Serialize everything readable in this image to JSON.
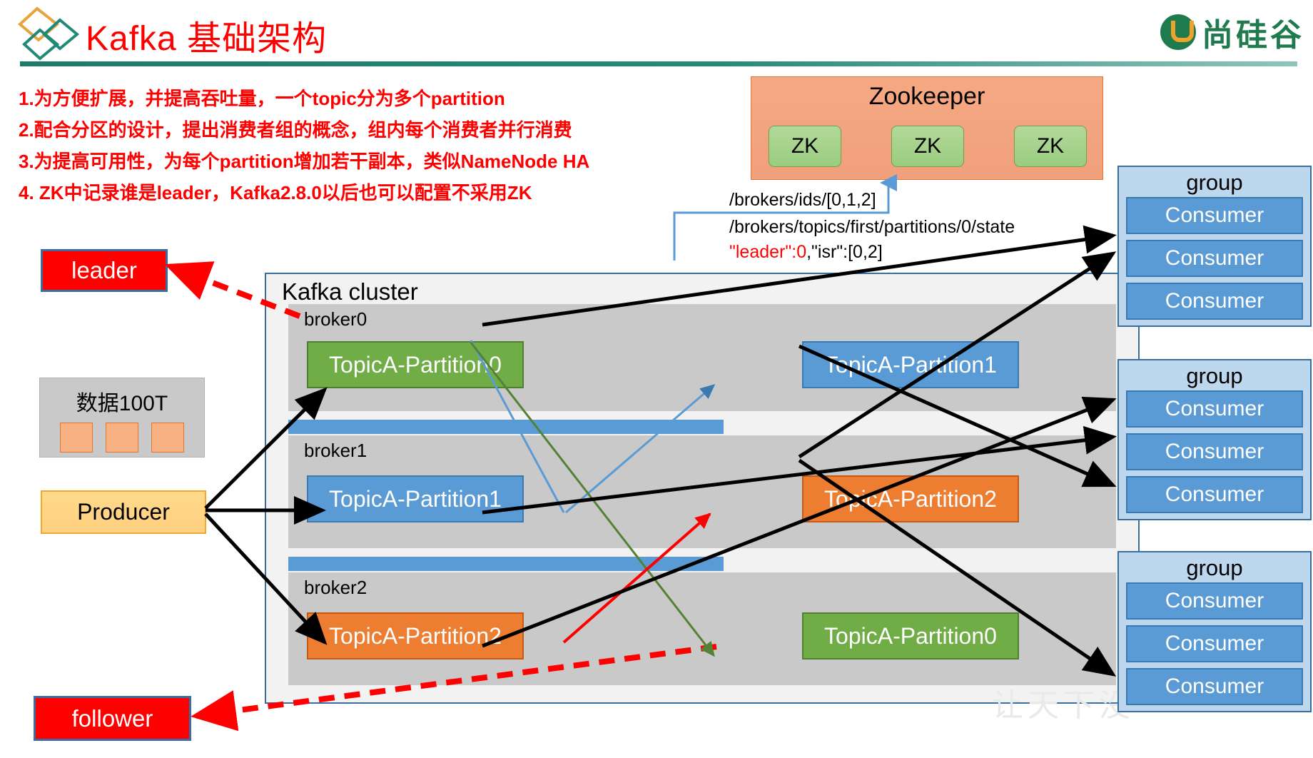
{
  "header": {
    "title": "Kafka 基础架构",
    "logo_icon": "diamonds-logo-icon",
    "brand_text": "尚硅谷",
    "brand_icon": "atguigu-u-mark-icon"
  },
  "notes": [
    "1.为方便扩展，并提高吞吐量，一个topic分为多个partition",
    "2.配合分区的设计，提出消费者组的概念，组内每个消费者并行消费",
    "3.为提高可用性，为每个partition增加若干副本，类似NameNode HA",
    "4. ZK中记录谁是leader，Kafka2.8.0以后也可以配置不采用ZK"
  ],
  "zookeeper": {
    "title": "Zookeeper",
    "nodes": [
      "ZK",
      "ZK",
      "ZK"
    ],
    "paths": {
      "ids": "/brokers/ids/[0,1,2]",
      "state": "/brokers/topics/first/partitions/0/state",
      "leader_value": "\"leader\":0",
      "isr_value": ",\"isr\":[0,2]"
    }
  },
  "legend": {
    "leader": "leader",
    "follower": "follower"
  },
  "left_panel": {
    "data_label": "数据100T",
    "producer": "Producer"
  },
  "cluster": {
    "title": "Kafka cluster",
    "brokers": [
      {
        "label": "broker0",
        "partitions": [
          {
            "name": "TopicA-Partition0",
            "color": "green"
          },
          {
            "name": "TopicA-Partition1",
            "color": "blue"
          }
        ]
      },
      {
        "label": "broker1",
        "partitions": [
          {
            "name": "TopicA-Partition1",
            "color": "blue"
          },
          {
            "name": "TopicA-Partition2",
            "color": "orange"
          }
        ]
      },
      {
        "label": "broker2",
        "partitions": [
          {
            "name": "TopicA-Partition2",
            "color": "orange"
          },
          {
            "name": "TopicA-Partition0",
            "color": "green"
          }
        ]
      }
    ]
  },
  "consumer_groups": [
    {
      "title": "group",
      "consumers": [
        "Consumer",
        "Consumer",
        "Consumer"
      ]
    },
    {
      "title": "group",
      "consumers": [
        "Consumer",
        "Consumer",
        "Consumer"
      ]
    },
    {
      "title": "group",
      "consumers": [
        "Consumer",
        "Consumer",
        "Consumer"
      ]
    }
  ],
  "watermark": "让天下没",
  "colors": {
    "title_red": "#ff0000",
    "partition_green": "#70ad47",
    "partition_blue": "#5b9bd5",
    "partition_orange": "#ed7d31",
    "zookeeper_bg": "#f0a07b",
    "zk_node": "#9acd7f",
    "group_bg": "#bdd7ee",
    "producer_bg": "#ffd080",
    "brand_green": "#1f7a4d"
  }
}
